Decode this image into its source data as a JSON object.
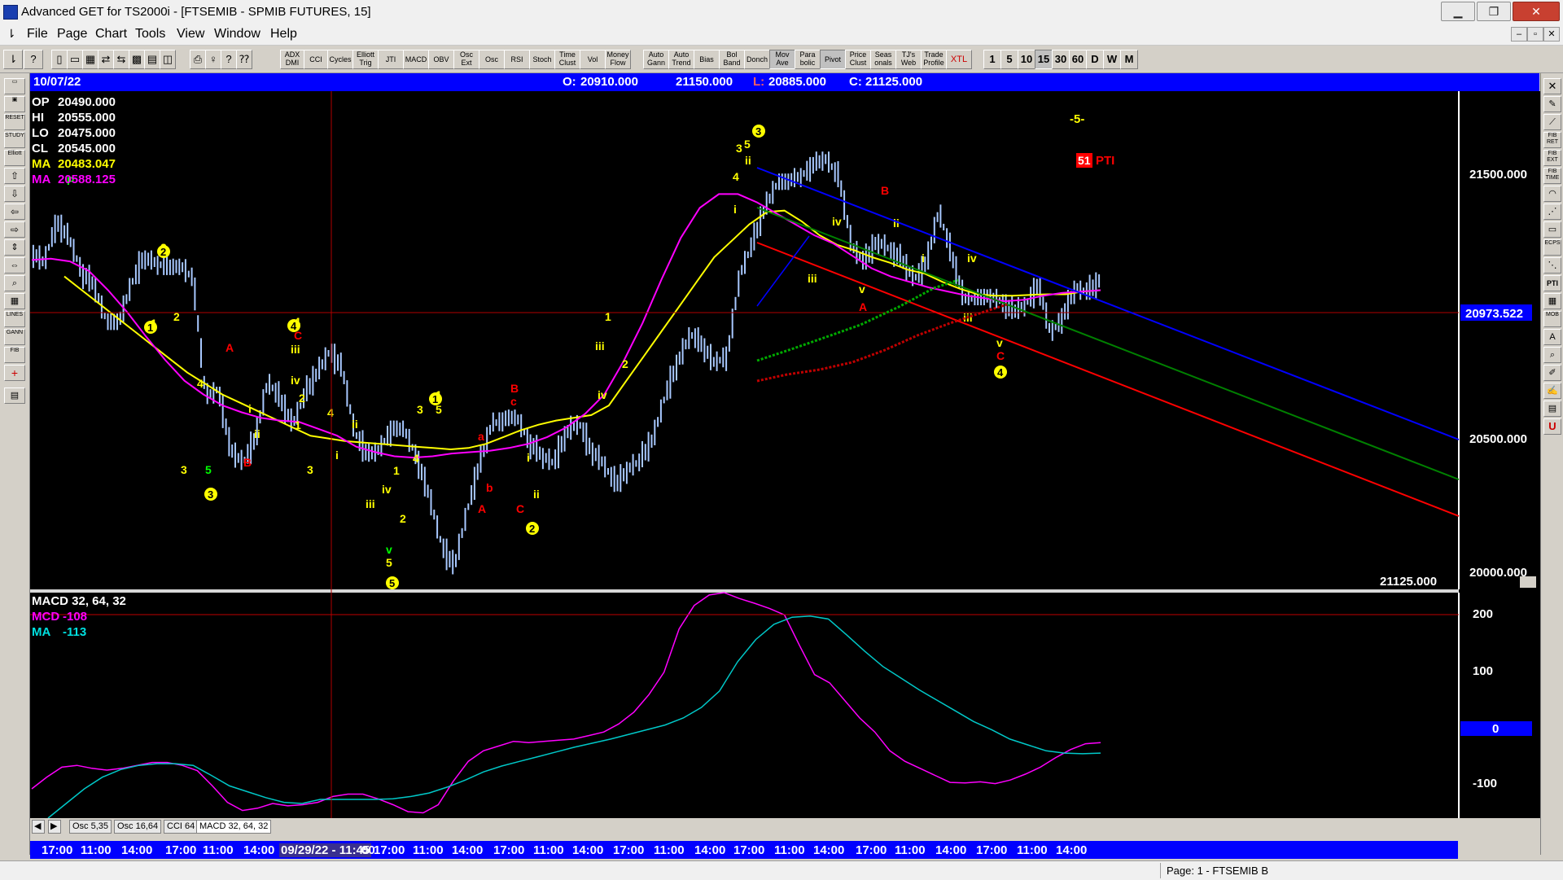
{
  "window": {
    "title": "Advanced GET for TS2000i - [FTSEMIB - SPMIB FUTURES, 15]"
  },
  "menu": [
    "File",
    "Page",
    "Chart",
    "Tools",
    "View",
    "Window",
    "Help"
  ],
  "toolbar": {
    "indicators": [
      "ADX DMI",
      "CCI",
      "Cycles",
      "Elliott Trig",
      "JTI",
      "MACD",
      "OBV",
      "Osc Ext",
      "Osc",
      "RSI",
      "Stoch",
      "Time Clust",
      "Vol",
      "Money Flow",
      "Auto Gann",
      "Auto Trend",
      "Bias",
      "Bol Band",
      "Donch",
      "Mov Ave",
      "Para bolic",
      "Pivot",
      "Price Clust",
      "Seas onals",
      "TJ's Web",
      "Trade Profile",
      "XTL"
    ],
    "timeframes": [
      "1",
      "5",
      "10",
      "15",
      "30",
      "60",
      "D",
      "W",
      "M"
    ]
  },
  "info": {
    "date": "10/07/22",
    "open_label": "O:",
    "open": "20910.000",
    "high": "21150.000",
    "low_label": "L:",
    "low": "20885.000",
    "close_label": "C:",
    "close": "21125.000"
  },
  "legend": {
    "op_label": "OP",
    "op": "20490.000",
    "hi_label": "HI",
    "hi": "20555.000",
    "lo_label": "LO",
    "lo": "20475.000",
    "cl_label": "CL",
    "cl": "20545.000",
    "ma1_label": "MA",
    "ma1": "20483.047",
    "ma2_label": "MA",
    "ma2": "20588.125"
  },
  "price_axis": {
    "labels": [
      "21500.000",
      "20500.000",
      "20000.000"
    ],
    "cursor_price": "20973.522",
    "last_close": "21125.000",
    "ymin": 19990,
    "ymax": 21805
  },
  "wave_labels": {
    "top_right": "-5-",
    "pti_value": "51",
    "pti_label": "PTI"
  },
  "macd": {
    "title": "MACD 32, 64, 32",
    "mcd_label": "MCD",
    "mcd": "-108",
    "ma_label": "MA",
    "ma": "-113",
    "axis": [
      "200",
      "100",
      "0",
      "-100"
    ],
    "ymin": -145,
    "ymax": 240,
    "ref_line": 200
  },
  "tabs": [
    "Osc 5,35",
    "Osc 16,64",
    "CCI 64",
    "MACD 32, 64, 32"
  ],
  "time_axis": [
    "17:00",
    "11:00",
    "14:00",
    "17:00",
    "11:00",
    "14:00",
    "09/29/22 - 11:45",
    "00",
    "17:00",
    "11:00",
    "14:00",
    "17:00",
    "11:00",
    "14:00",
    "17:00",
    "11:00",
    "14:00",
    "17:00",
    "11:00",
    "14:00",
    "17:00",
    "11:00",
    "14:00",
    "17:00",
    "11:00",
    "14:00"
  ],
  "status": "Page: 1 - FTSEMIB B",
  "colors": {
    "ma1": "#ffff00",
    "ma2": "#ff00ff",
    "bars": "#a8c8ff",
    "channel_top": "#0000ff",
    "channel_mid": "#008000",
    "channel_low": "#ff0000",
    "macd": "#ff00ff",
    "macd_ma": "#00c8c8",
    "wave_yellow": "#ffff00",
    "wave_red": "#ff0000",
    "wave_green": "#00ff00"
  },
  "chart_data": [
    {
      "type": "line",
      "title": "FTSEMIB - SPMIB FUTURES, 15",
      "y_range": [
        19990,
        21805
      ],
      "series": [
        {
          "name": "Price",
          "values": [
            21220,
            21180,
            21330,
            21270,
            21150,
            21100,
            20970,
            20960,
            21100,
            21200,
            21180,
            21160,
            21170,
            21120,
            20690,
            20720,
            20500,
            20450,
            20540,
            20750,
            20680,
            20590,
            20700,
            20780,
            20860,
            20790,
            20560,
            20480,
            20500,
            20580,
            20570,
            20470,
            20330,
            20150,
            20070,
            20270,
            20440,
            20590,
            20610,
            20620,
            20530,
            20480,
            20450,
            20560,
            20600,
            20500,
            20450,
            20370,
            20430,
            20460,
            20540,
            20700,
            20820,
            20920,
            20880,
            20810,
            20850,
            21140,
            21250,
            21380,
            21470,
            21480,
            21500,
            21540,
            21560,
            21480,
            21240,
            21180,
            21260,
            21230,
            21190,
            21120,
            21180,
            21370,
            21210,
            21050,
            21050,
            21060,
            21040,
            21000,
            21030,
            21100,
            20920,
            20990,
            21090,
            21070,
            21120
          ]
        },
        {
          "name": "MA 20483.047",
          "values": [
            21130,
            21080,
            21030,
            20980,
            20930,
            20880,
            20830,
            20780,
            20740,
            20700,
            20670,
            20640,
            20610,
            20580,
            20550,
            20540,
            20530,
            20525,
            20520,
            20515,
            20510,
            20505,
            20500,
            20505,
            20520,
            20545,
            20570,
            20590,
            20605,
            20615,
            20625,
            20660,
            20750,
            20840,
            20930,
            21020,
            21110,
            21200,
            21260,
            21320,
            21365,
            21370,
            21330,
            21280,
            21245,
            21225,
            21200,
            21180,
            21155,
            21140,
            21110,
            21085,
            21065,
            21060,
            21060,
            21063,
            21065,
            21065,
            21075,
            21080
          ]
        },
        {
          "name": "MA 20588.125",
          "values": [
            21190,
            21195,
            21185,
            21150,
            21080,
            21000,
            20910,
            20825,
            20750,
            20700,
            20660,
            20635,
            20615,
            20605,
            20600,
            20575,
            20550,
            20510,
            20490,
            20475,
            20470,
            20475,
            20485,
            20490,
            20495,
            20505,
            20520,
            20545,
            20580,
            20630,
            20700,
            20820,
            20960,
            21120,
            21270,
            21380,
            21430,
            21430,
            21400,
            21360,
            21320,
            21280,
            21250,
            21205,
            21160,
            21130,
            21110,
            21090,
            21075,
            21060,
            21050,
            21040,
            21045,
            21060,
            21070,
            21075,
            21080
          ]
        }
      ]
    },
    {
      "type": "line",
      "title": "MACD 32, 64, 32",
      "y_range": [
        -145,
        240
      ],
      "series": [
        {
          "name": "MCD",
          "values": [
            -95,
            -75,
            -58,
            -55,
            -60,
            -63,
            -60,
            -55,
            -50,
            -50,
            -55,
            -64,
            -90,
            -118,
            -132,
            -128,
            -120,
            -124,
            -122,
            -118,
            -108,
            -104,
            -104,
            -112,
            -122,
            -134,
            -136,
            -122,
            -82,
            -48,
            -30,
            -22,
            -14,
            -16,
            -14,
            -12,
            -10,
            -4,
            2,
            16,
            36,
            66,
            104,
            178,
            218,
            236,
            240,
            230,
            222,
            213,
            202,
            150,
            100,
            86,
            56,
            26,
            2,
            -30,
            -48,
            -60,
            -72,
            -84,
            -85,
            -83,
            -86,
            -80,
            -70,
            -58,
            -42,
            -28,
            -18,
            -16
          ]
        },
        {
          "name": "MA",
          "values": [
            -145,
            -120,
            -95,
            -75,
            -62,
            -55,
            -52,
            -52,
            -55,
            -72,
            -90,
            -100,
            -110,
            -118,
            -120,
            -113,
            -113,
            -113,
            -113,
            -112,
            -108,
            -102,
            -92,
            -80,
            -66,
            -56,
            -48,
            -40,
            -32,
            -24,
            -17,
            -10,
            -2,
            6,
            14,
            26,
            44,
            72,
            122,
            160,
            186,
            198,
            200,
            195,
            168,
            140,
            114,
            94,
            74,
            56,
            38,
            20,
            6,
            -10,
            -20,
            -30,
            -34,
            -35,
            -34
          ]
        }
      ]
    }
  ]
}
